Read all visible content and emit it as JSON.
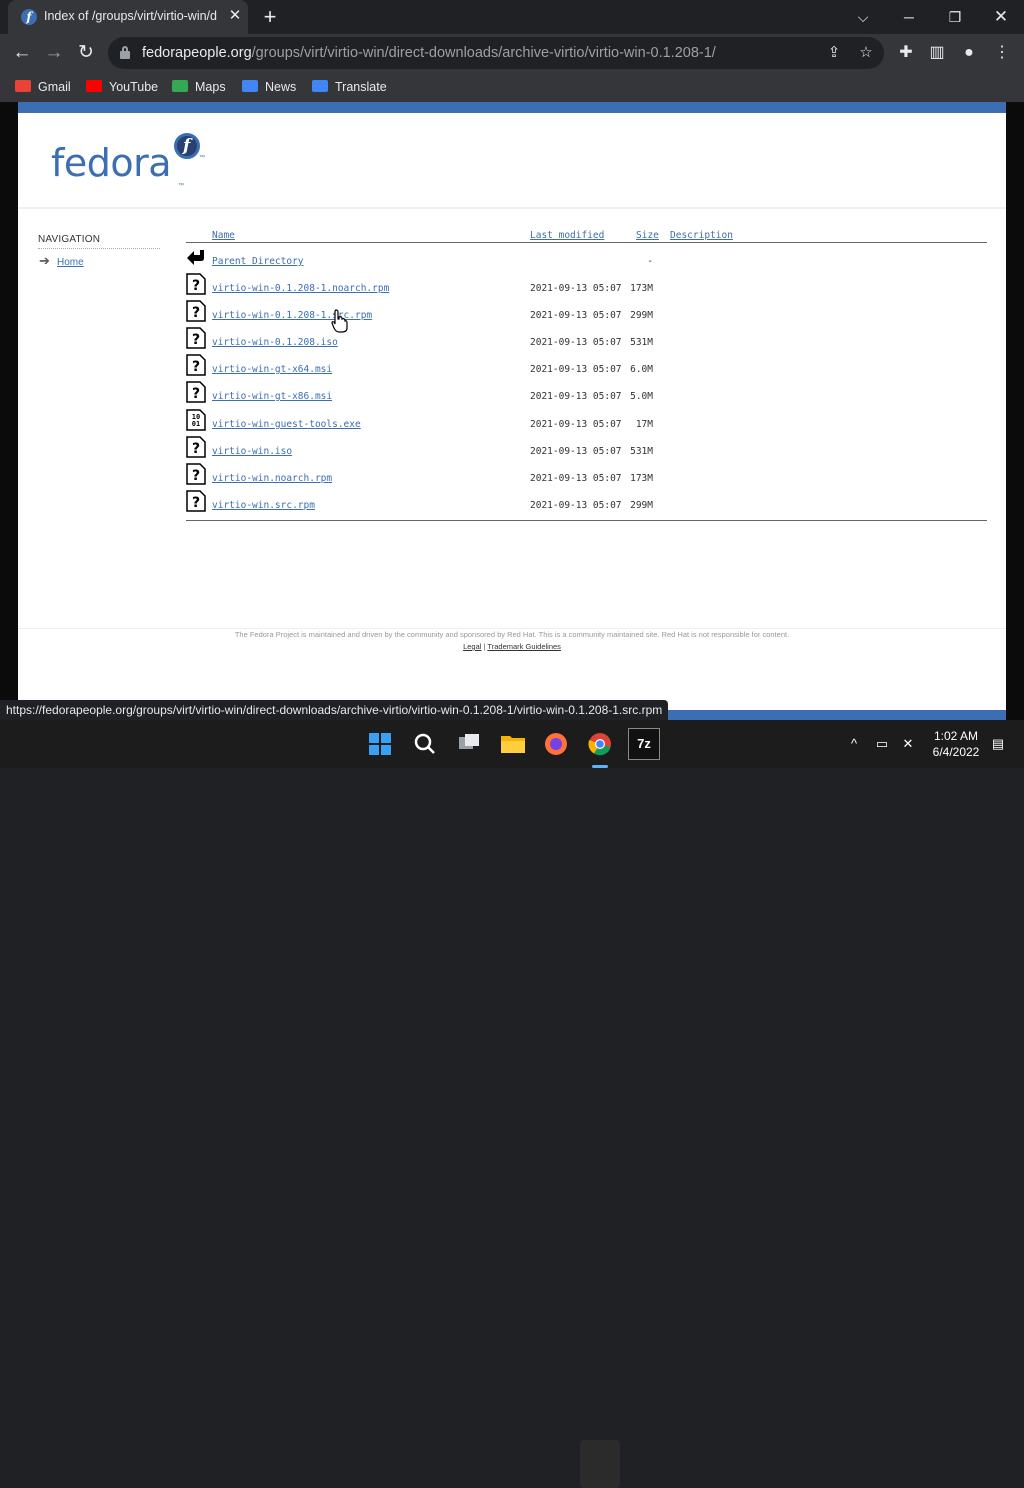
{
  "browser": {
    "tab_title": "Index of /groups/virt/virtio-win/d",
    "tab_favicon": "f",
    "url_host": "fedorapeople.org",
    "url_path": "/groups/virt/virtio-win/direct-downloads/archive-virtio/virtio-win-0.1.208-1/",
    "bookmarks": [
      {
        "label": "Gmail",
        "icon": "gmail-icon",
        "color": "#ea4335"
      },
      {
        "label": "YouTube",
        "icon": "youtube-icon",
        "color": "#ff0000"
      },
      {
        "label": "Maps",
        "icon": "maps-icon",
        "color": "#34a853"
      },
      {
        "label": "News",
        "icon": "news-icon",
        "color": "#4285f4"
      },
      {
        "label": "Translate",
        "icon": "translate-icon",
        "color": "#4285f4"
      }
    ],
    "status_url": "https://fedorapeople.org/groups/virt/virtio-win/direct-downloads/archive-virtio/virtio-win-0.1.208-1/virtio-win-0.1.208-1.src.rpm"
  },
  "page": {
    "logo_text": "fedora",
    "logo_mark": "f",
    "nav_title": "NAVIGATION",
    "nav_home": "Home",
    "columns": {
      "name": "Name",
      "modified": "Last modified",
      "size": "Size",
      "description": "Description"
    },
    "rows": [
      {
        "name": "Parent Directory",
        "modified": "",
        "size": "-",
        "icon": "back-icon"
      },
      {
        "name": "virtio-win-0.1.208-1.noarch.rpm",
        "modified": "2021-09-13 05:07",
        "size": "173M",
        "icon": "unknown-file-icon"
      },
      {
        "name": "virtio-win-0.1.208-1.src.rpm",
        "modified": "2021-09-13 05:07",
        "size": "299M",
        "icon": "unknown-file-icon"
      },
      {
        "name": "virtio-win-0.1.208.iso",
        "modified": "2021-09-13 05:07",
        "size": "531M",
        "icon": "unknown-file-icon"
      },
      {
        "name": "virtio-win-gt-x64.msi",
        "modified": "2021-09-13 05:07",
        "size": "6.0M",
        "icon": "unknown-file-icon"
      },
      {
        "name": "virtio-win-gt-x86.msi",
        "modified": "2021-09-13 05:07",
        "size": "5.0M",
        "icon": "unknown-file-icon"
      },
      {
        "name": "virtio-win-guest-tools.exe",
        "modified": "2021-09-13 05:07",
        "size": "17M",
        "icon": "binary-file-icon"
      },
      {
        "name": "virtio-win.iso",
        "modified": "2021-09-13 05:07",
        "size": "531M",
        "icon": "unknown-file-icon"
      },
      {
        "name": "virtio-win.noarch.rpm",
        "modified": "2021-09-13 05:07",
        "size": "173M",
        "icon": "unknown-file-icon"
      },
      {
        "name": "virtio-win.src.rpm",
        "modified": "2021-09-13 05:07",
        "size": "299M",
        "icon": "unknown-file-icon"
      }
    ],
    "footer_text": "The Fedora Project is maintained and driven by the community and sponsored by Red Hat. This is a community maintained site. Red Hat is not responsible for content.",
    "footer_links": [
      "Legal",
      "Trademark Guidelines"
    ],
    "footer_sep": "|"
  },
  "taskbar": {
    "time": "1:02 AM",
    "date": "6/4/2022",
    "apps": [
      "start-icon",
      "search-icon",
      "task-view-icon",
      "file-explorer-icon",
      "firefox-icon",
      "chrome-icon",
      "7zip-icon"
    ],
    "sevenzip_label": "7z"
  },
  "colors": {
    "fedora_blue": "#3c6eb4",
    "chrome_dark": "#202124",
    "chrome_toolbar": "#35363a"
  }
}
